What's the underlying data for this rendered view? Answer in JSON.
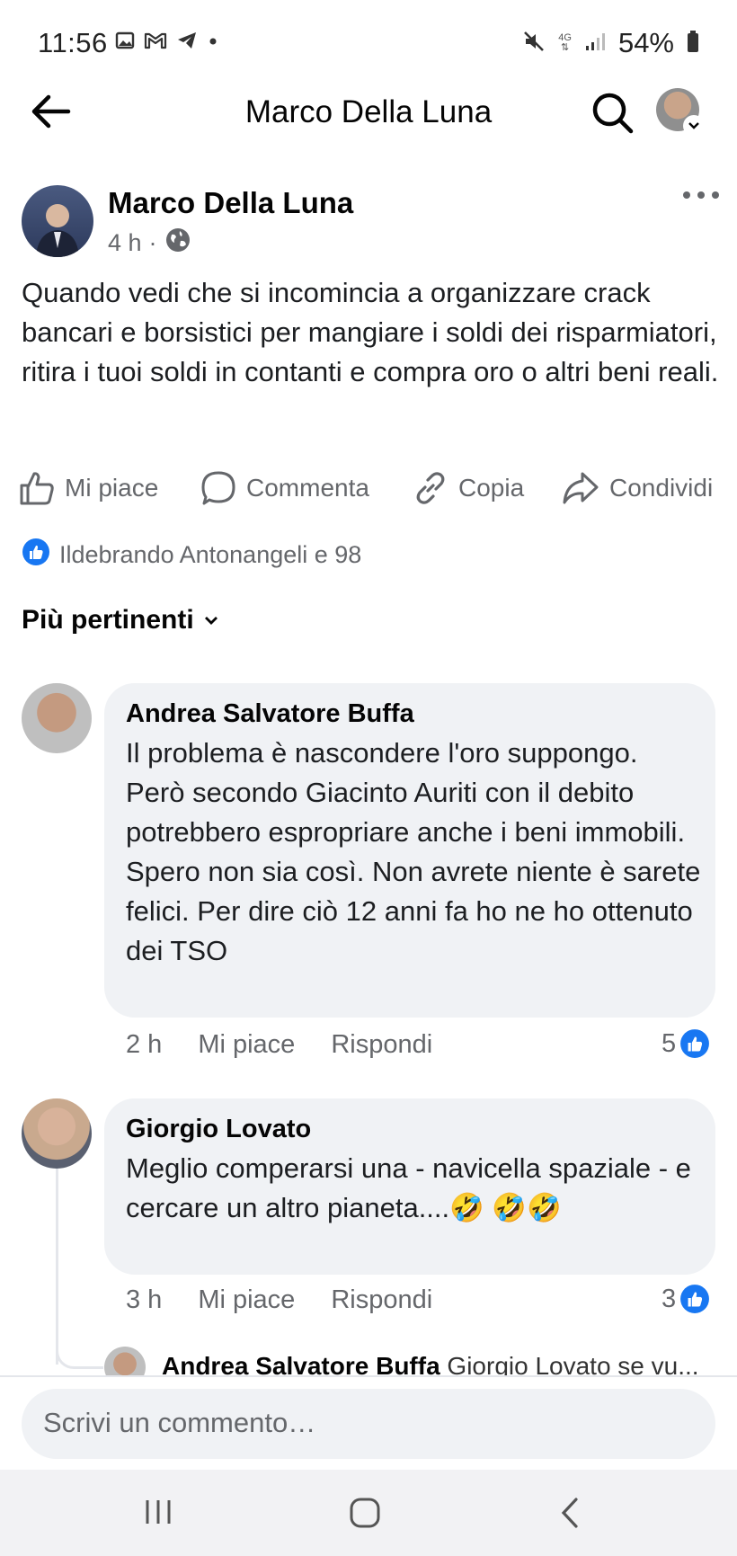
{
  "status_bar": {
    "time": "11:56",
    "battery": "54%",
    "network": "4G"
  },
  "header": {
    "title": "Marco Della Luna"
  },
  "post": {
    "author": "Marco Della Luna",
    "time": "4 h",
    "separator": "·",
    "visibility_icon": "globe-icon",
    "text": "Quando vedi che si incomincia a organizzare crack bancari e borsistici per mangiare i soldi dei risparmiatori, ritira i tuoi soldi in contanti e compra oro o altri beni reali.",
    "actions": {
      "like": "Mi piace",
      "comment": "Commenta",
      "copy": "Copia",
      "share": "Condividi"
    },
    "reactions_summary": "Ildebrando Antonangeli e 98"
  },
  "comments_sort": "Più pertinenti",
  "comments": [
    {
      "author": "Andrea Salvatore Buffa",
      "text": "Il problema è nascondere l'oro suppongo. Però secondo Giacinto Auriti con il debito potrebbero espropriare anche i beni immobili. Spero non sia così. Non avrete niente è sarete felici. Per dire ciò 12 anni fa ho ne ho ottenuto dei TSO",
      "time": "2 h",
      "like": "Mi piace",
      "reply": "Rispondi",
      "reactions": "5"
    },
    {
      "author": "Giorgio Lovato",
      "text": "Meglio comperarsi una - navicella spaziale - e cercare un altro pianeta....",
      "emoji": "🤣",
      "time": "3 h",
      "like": "Mi piace",
      "reply": "Rispondi",
      "reactions": "3"
    }
  ],
  "reply_preview": {
    "author": "Andrea Salvatore Buffa",
    "text": "Giorgio Lovato se vu..."
  },
  "composer": {
    "placeholder": "Scrivi un commento…"
  },
  "colors": {
    "accent": "#1877f2",
    "bubble": "#f0f2f5",
    "secondary_text": "#65676b"
  }
}
